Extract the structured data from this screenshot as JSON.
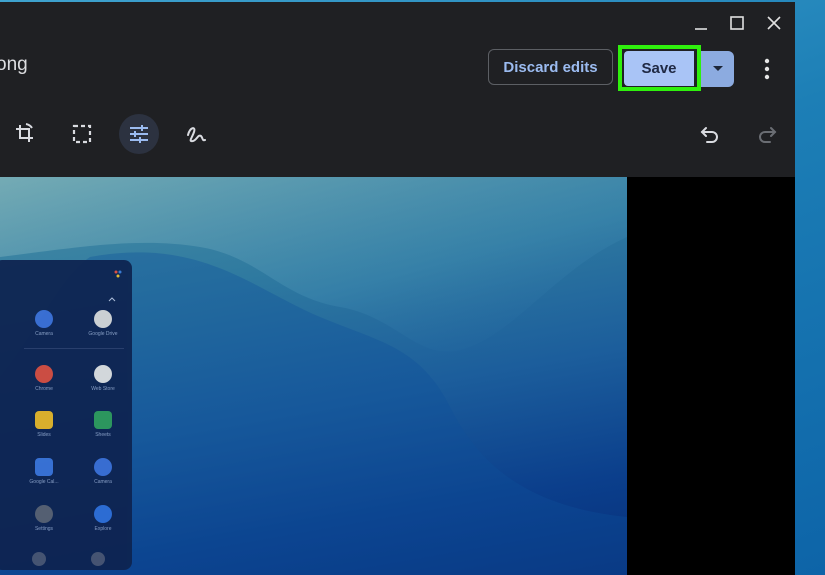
{
  "window": {
    "title": "ong",
    "controls": [
      "minimize-icon",
      "maximize-icon",
      "close-icon"
    ]
  },
  "header": {
    "discard_label": "Discard edits",
    "save_label": "Save"
  },
  "toolbar": {
    "tools": [
      "rotate-crop-icon",
      "select-region-icon",
      "adjust-sliders-icon",
      "markup-pen-icon"
    ],
    "active_tool": "adjust-sliders-icon",
    "undo": "undo-icon",
    "redo": "redo-icon"
  },
  "launcher": {
    "apps": [
      {
        "label": "Camera",
        "color": "#3b6fd6"
      },
      {
        "label": "Google Drive",
        "color": "#d8d8d8"
      },
      {
        "label": "Chrome",
        "color": "#d94c3d"
      },
      {
        "label": "Web Store",
        "color": "#e0e0e0"
      },
      {
        "label": "Slides",
        "color": "#e7b625"
      },
      {
        "label": "Sheets",
        "color": "#2e9b5a"
      },
      {
        "label": "Google Cal...",
        "color": "#3a73d8"
      },
      {
        "label": "Camera",
        "color": "#3b6fd6"
      },
      {
        "label": "Settings",
        "color": "#5a6170"
      },
      {
        "label": "Explore",
        "color": "#2f6fd8"
      }
    ]
  },
  "colors": {
    "highlight": "#2ff00d",
    "save_button": "#a9c4f6",
    "accent_text": "#9bbbf0"
  }
}
